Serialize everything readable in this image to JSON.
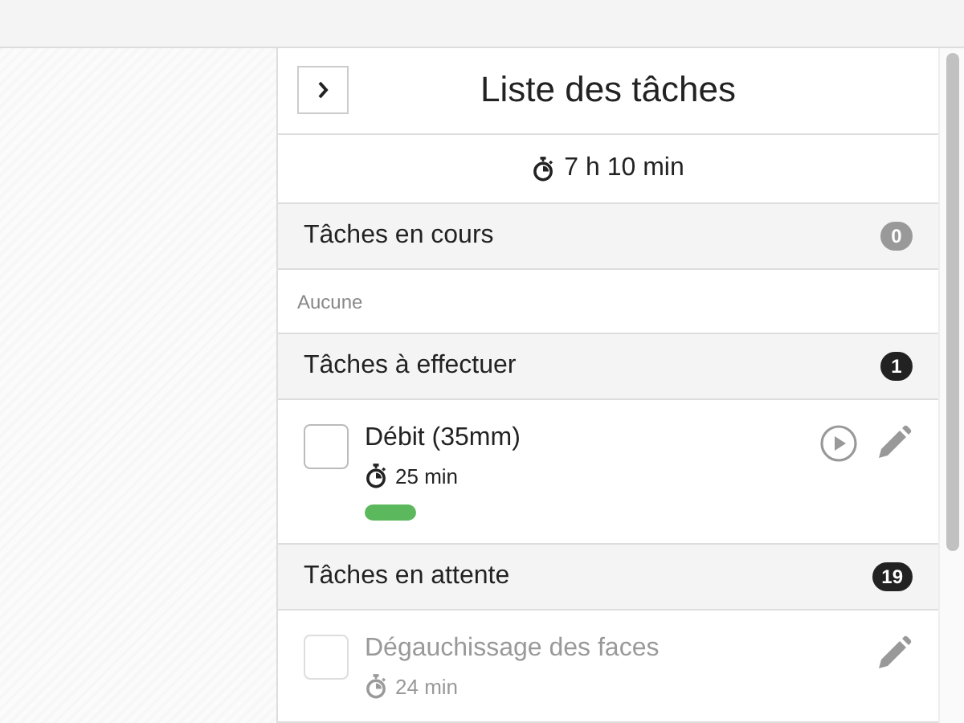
{
  "panel": {
    "title": "Liste des tâches",
    "total": "7 h 10 min"
  },
  "sections": [
    {
      "title": "Tâches en cours",
      "count": "0",
      "color": "#999999",
      "empty_text": "Aucune"
    },
    {
      "title": "Tâches à effectuer",
      "count": "1",
      "color": "#222222",
      "tasks": [
        {
          "title": "Débit (35mm)",
          "duration": "25 min",
          "checked": false,
          "disabled": false,
          "playable": true,
          "tags": [
            {
              "color": "#5cb85c"
            }
          ]
        }
      ]
    },
    {
      "title": "Tâches en attente",
      "count": "19",
      "color": "#222222",
      "tasks": [
        {
          "title": "Dégauchissage des faces",
          "duration": "24 min",
          "checked": false,
          "disabled": true,
          "playable": false
        }
      ]
    }
  ]
}
